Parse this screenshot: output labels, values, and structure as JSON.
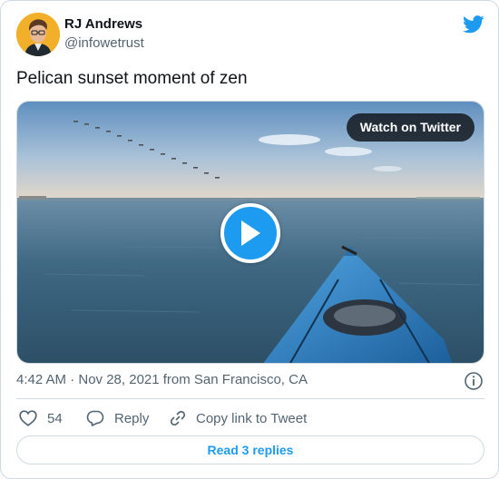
{
  "author": {
    "name": "RJ Andrews",
    "handle": "@infowetrust",
    "avatar_icon": "avatar-portrait"
  },
  "tweet": {
    "text": "Pelican sunset moment of zen"
  },
  "media": {
    "watch_label": "Watch on Twitter",
    "play_icon": "play-icon"
  },
  "meta": {
    "timestamp": "4:42 AM · Nov 28, 2021 from San Francisco, CA"
  },
  "actions": {
    "like_count": "54",
    "reply_label": "Reply",
    "copy_label": "Copy link to Tweet"
  },
  "footer": {
    "read_replies_label": "Read 3 replies"
  },
  "colors": {
    "accent": "#1d9bf0",
    "text_primary": "#0f1419",
    "text_secondary": "#536471",
    "border": "#cfd9de"
  }
}
